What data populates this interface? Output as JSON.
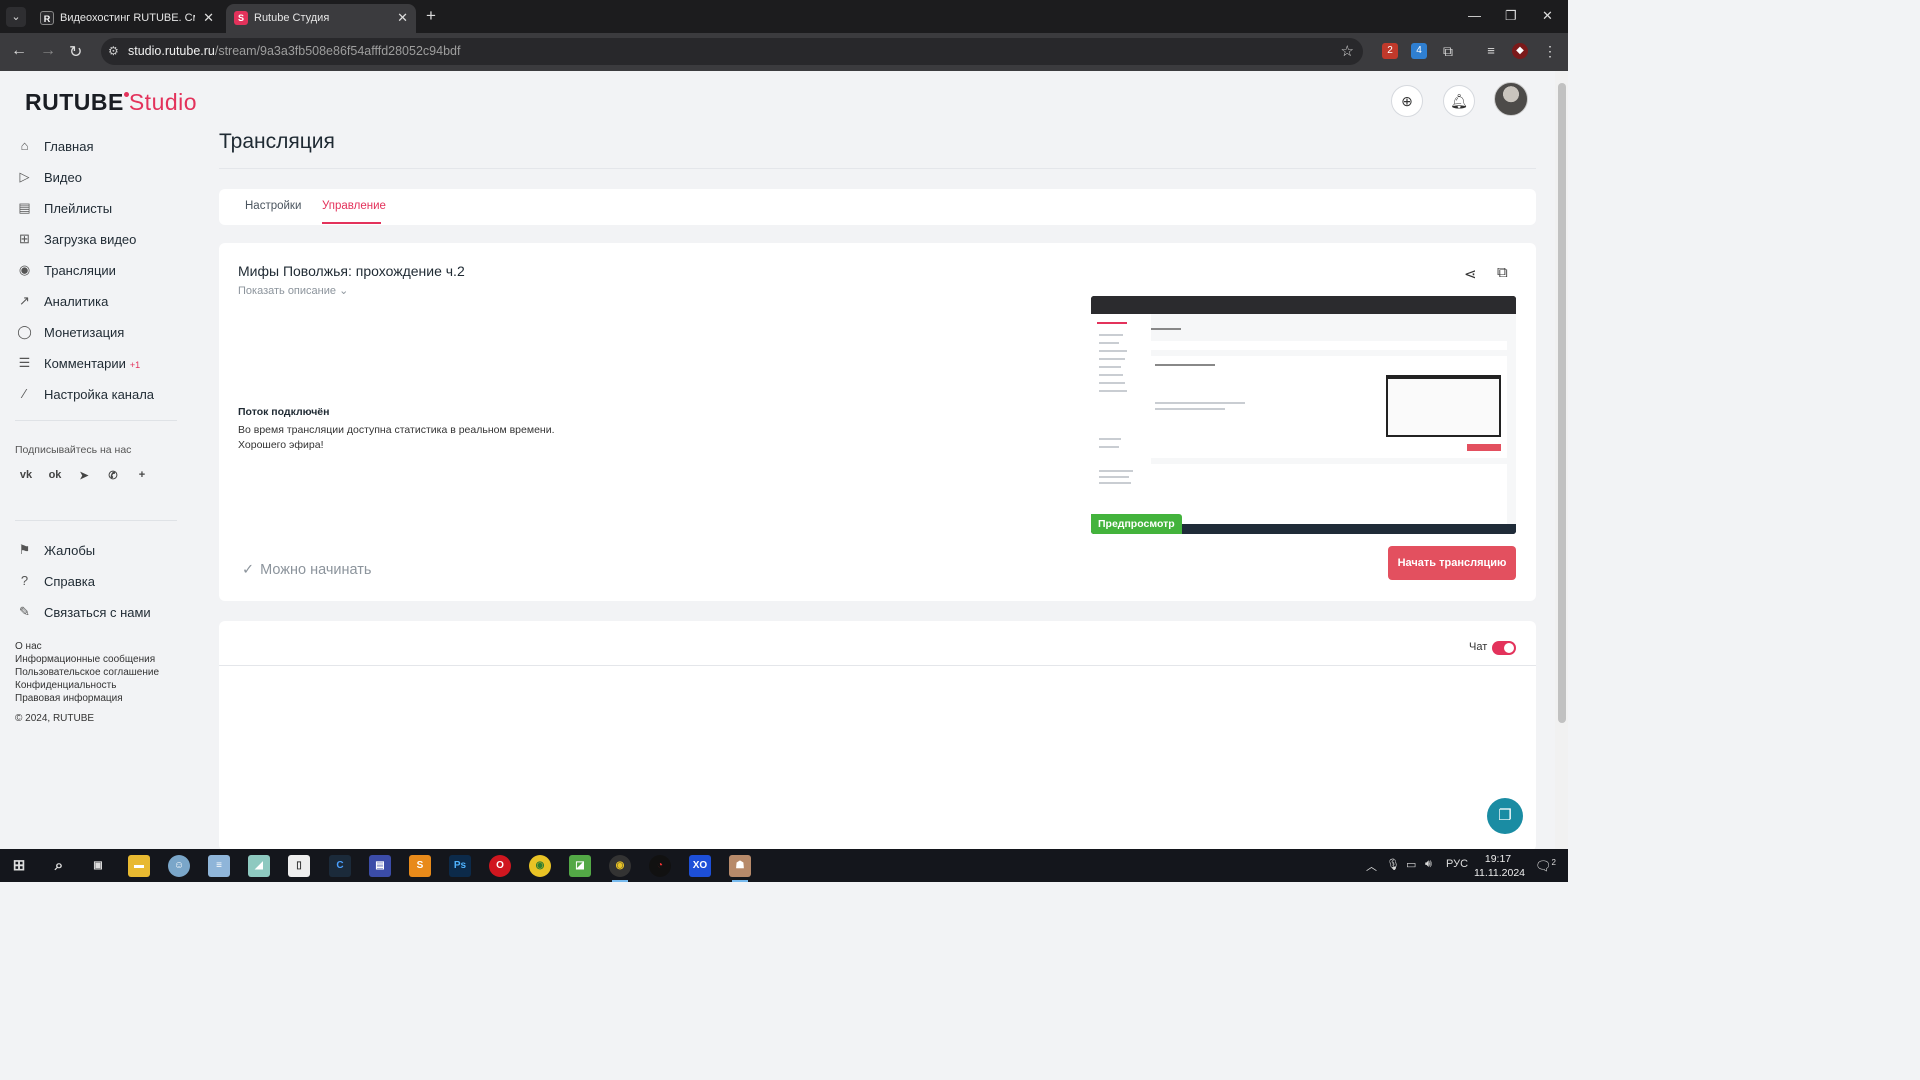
{
  "browser": {
    "tabs": [
      {
        "label": "Видеохостинг RUTUBE. Смотр",
        "favicon": "R"
      },
      {
        "label": "Rutube Студия",
        "favicon": "S"
      }
    ],
    "url_host": "studio.rutube.ru",
    "url_path": "/stream/9a3a3fb508e86f54afffd28052c94bdf",
    "extension_badges": [
      "2",
      "4"
    ]
  },
  "header": {
    "logo_main": "RUTUBE",
    "logo_sub": "Studio"
  },
  "sidebar": {
    "items": [
      {
        "label": "Главная",
        "icon": "home-icon"
      },
      {
        "label": "Видео",
        "icon": "video-icon"
      },
      {
        "label": "Плейлисты",
        "icon": "playlist-icon"
      },
      {
        "label": "Загрузка видео",
        "icon": "upload-icon"
      },
      {
        "label": "Трансляции",
        "icon": "broadcast-icon"
      },
      {
        "label": "Аналитика",
        "icon": "analytics-icon"
      },
      {
        "label": "Монетизация",
        "icon": "monetization-icon"
      },
      {
        "label": "Комментарии",
        "icon": "comments-icon",
        "badge": "+1"
      },
      {
        "label": "Настройка канала",
        "icon": "magic-wand-icon"
      }
    ],
    "follow_title": "Подписывайтесь на нас",
    "socials": [
      "vk-icon",
      "ok-icon",
      "telegram-icon",
      "viber-icon",
      "plus-icon"
    ],
    "bottom_items": [
      {
        "label": "Жалобы",
        "icon": "flag-icon"
      },
      {
        "label": "Справка",
        "icon": "help-icon"
      },
      {
        "label": "Связаться с нами",
        "icon": "edit-icon"
      }
    ],
    "footer_links": [
      "О нас",
      "Информационные сообщения",
      "Пользовательское соглашение",
      "Конфиденциальность",
      "Правовая информация"
    ],
    "copyright": "© 2024, RUTUBE"
  },
  "main": {
    "page_title": "Трансляция",
    "tabs": [
      {
        "label": "Настройки",
        "active": false
      },
      {
        "label": "Управление",
        "active": true
      }
    ],
    "stream": {
      "title": "Мифы Поволжья: прохождение ч.2",
      "show_description": "Показать описание",
      "status_title": "Поток подключён",
      "status_line1": "Во время трансляции доступна статистика в реальном времени.",
      "status_line2": "Хорошего эфира!",
      "preview_label": "Предпросмотр",
      "ready_text": "Можно начинать",
      "start_button": "Начать трансляцию"
    },
    "chat": {
      "label": "Чат",
      "enabled": true
    }
  },
  "taskbar": {
    "lang": "РУС",
    "time": "19:17",
    "date": "11.11.2024",
    "notification_count": "2"
  },
  "colors": {
    "accent": "#e3325b",
    "button": "#e3505f",
    "preview_badge": "#43b33c",
    "help_fab": "#1a8ca3"
  }
}
